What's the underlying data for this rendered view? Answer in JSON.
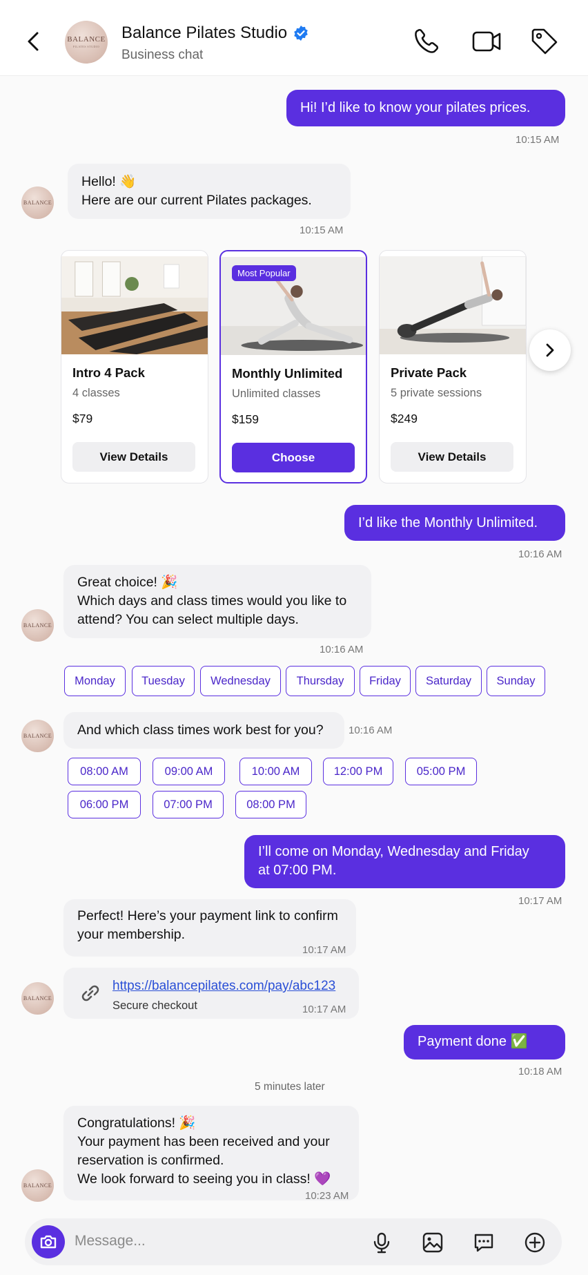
{
  "header": {
    "title": "Balance Pilates Studio",
    "subtitle": "Business chat",
    "avatar_text": "BALANCE",
    "avatar_small": "PILATES STUDIO"
  },
  "messages": {
    "m1": {
      "text": "Hi! I’d like to know your pilates prices.",
      "time": "10:15 AM"
    },
    "m2": {
      "line1": "Hello! 👋",
      "line2": "Here are our current Pilates packages.",
      "time": "10:15 AM"
    },
    "m3": {
      "text": "I’d like the Monthly Unlimited.",
      "time": "10:16 AM"
    },
    "m4": {
      "line1": "Great choice! 🎉",
      "line2": "Which days and class times would you like to",
      "line3": "attend? You can select multiple days.",
      "time": "10:16 AM"
    },
    "m5": {
      "text": "And which class times work best for you?",
      "time": "10:16 AM"
    },
    "m6": {
      "line1": "I’ll come on Monday, Wednesday and Friday",
      "line2": "at 07:00 PM.",
      "time": "10:17 AM"
    },
    "m7": {
      "line1": "Perfect! Here’s your payment link to confirm",
      "line2": "your membership.",
      "time": "10:17 AM"
    },
    "m8": {
      "url": "https://balancepilates.com/pay/abc123",
      "caption": "Secure checkout",
      "time": "10:17 AM"
    },
    "m9": {
      "text": "Payment done ✅",
      "time": "10:18 AM"
    },
    "separator": "5 minutes later",
    "m10": {
      "line1": "Congratulations! 🎉",
      "line2": "Your payment has been received and your",
      "line3": "reservation is confirmed.",
      "line4": "We look forward to seeing you in class! 💜",
      "time": "10:23 AM"
    }
  },
  "cards": [
    {
      "title": "Intro 4 Pack",
      "subtitle": "4 classes",
      "price": "$79",
      "button": "View Details"
    },
    {
      "badge": "Most Popular",
      "title": "Monthly Unlimited",
      "subtitle": "Unlimited classes",
      "price": "$159",
      "button": "Choose"
    },
    {
      "title": "Private Pack",
      "subtitle": "5 private sessions",
      "price": "$249",
      "button": "View Details"
    }
  ],
  "days": [
    "Monday",
    "Tuesday",
    "Wednesday",
    "Thursday",
    "Friday",
    "Saturday",
    "Sunday"
  ],
  "times": [
    "08:00 AM",
    "09:00 AM",
    "10:00 AM",
    "12:00 PM",
    "05:00 PM",
    "06:00 PM",
    "07:00 PM",
    "08:00 PM"
  ],
  "composer": {
    "placeholder": "Message..."
  },
  "colors": {
    "accent": "#5a2fe0",
    "verified": "#1f7bf2",
    "link": "#2a4fd6"
  }
}
